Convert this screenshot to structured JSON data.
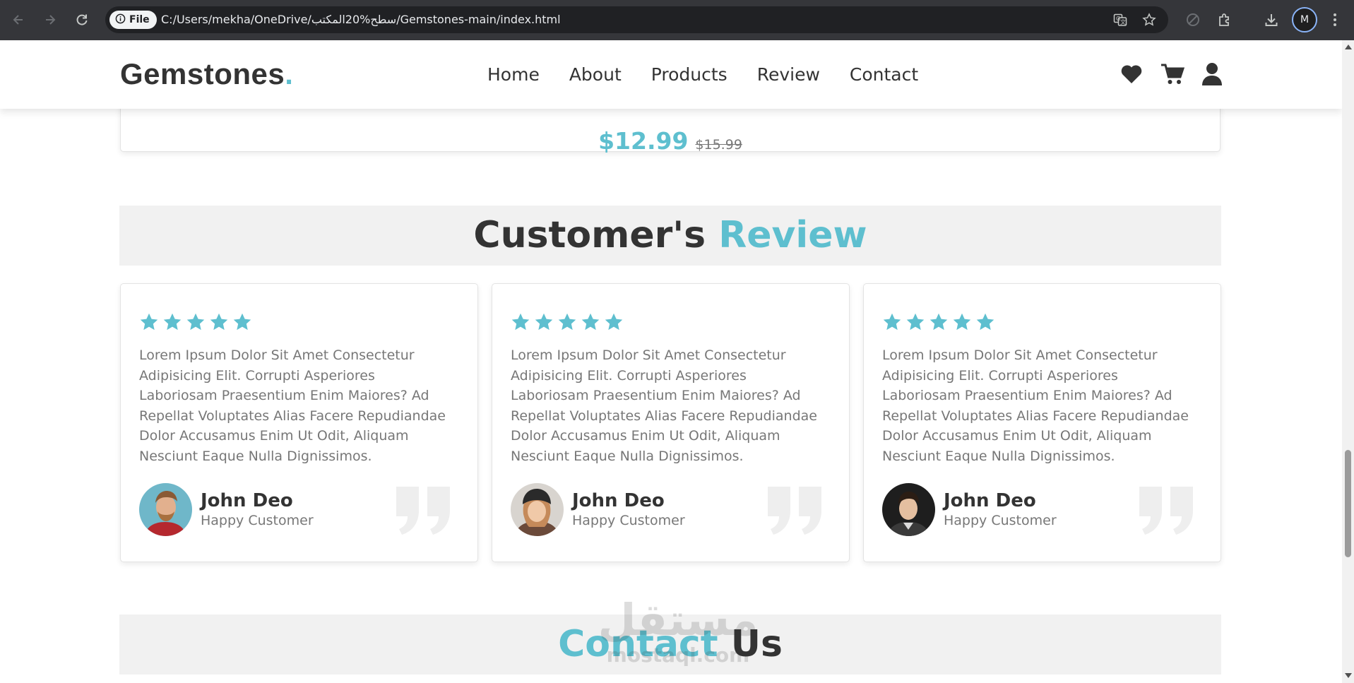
{
  "browser": {
    "file_chip": "File",
    "url": "C:/Users/mekha/OneDrive/سطح%20المكتب/Gemstones-main/index.html",
    "profile_initial": "M"
  },
  "site": {
    "logo_text": "Gemstones",
    "logo_dot": ".",
    "nav": [
      "Home",
      "About",
      "Products",
      "Review",
      "Contact"
    ]
  },
  "product": {
    "price": "$12.99",
    "old_price": "$15.99"
  },
  "review_section": {
    "heading_main": "Customer's",
    "heading_accent": "Review",
    "reviews": [
      {
        "rating": 5,
        "text": "Lorem Ipsum Dolor Sit Amet Consectetur Adipisicing Elit. Corrupti Asperiores Laboriosam Praesentium Enim Maiores? Ad Repellat Voluptates Alias Facere Repudiandae Dolor Accusamus Enim Ut Odit, Aliquam Nesciunt Eaque Nulla Dignissimos.",
        "name": "John Deo",
        "role": "Happy Customer"
      },
      {
        "rating": 5,
        "text": "Lorem Ipsum Dolor Sit Amet Consectetur Adipisicing Elit. Corrupti Asperiores Laboriosam Praesentium Enim Maiores? Ad Repellat Voluptates Alias Facere Repudiandae Dolor Accusamus Enim Ut Odit, Aliquam Nesciunt Eaque Nulla Dignissimos.",
        "name": "John Deo",
        "role": "Happy Customer"
      },
      {
        "rating": 5,
        "text": "Lorem Ipsum Dolor Sit Amet Consectetur Adipisicing Elit. Corrupti Asperiores Laboriosam Praesentium Enim Maiores? Ad Repellat Voluptates Alias Facere Repudiandae Dolor Accusamus Enim Ut Odit, Aliquam Nesciunt Eaque Nulla Dignissimos.",
        "name": "John Deo",
        "role": "Happy Customer"
      }
    ]
  },
  "contact_section": {
    "heading_accent": "Contact",
    "heading_main": "Us"
  },
  "watermark": {
    "arabic": "مستقل",
    "latin": "mostaql.com"
  },
  "colors": {
    "accent": "#5ebfcf",
    "text_dark": "#333333",
    "text_muted": "#777777",
    "band_bg": "#f1f1f1",
    "chrome_bg": "#35363a"
  },
  "icons": {
    "header": [
      "heart-icon",
      "cart-icon",
      "user-icon"
    ],
    "browser": [
      "back-icon",
      "forward-icon",
      "reload-icon",
      "info-icon",
      "translate-icon",
      "star-icon",
      "extension-blocked-icon",
      "extensions-icon",
      "download-icon",
      "menu-icon"
    ]
  }
}
